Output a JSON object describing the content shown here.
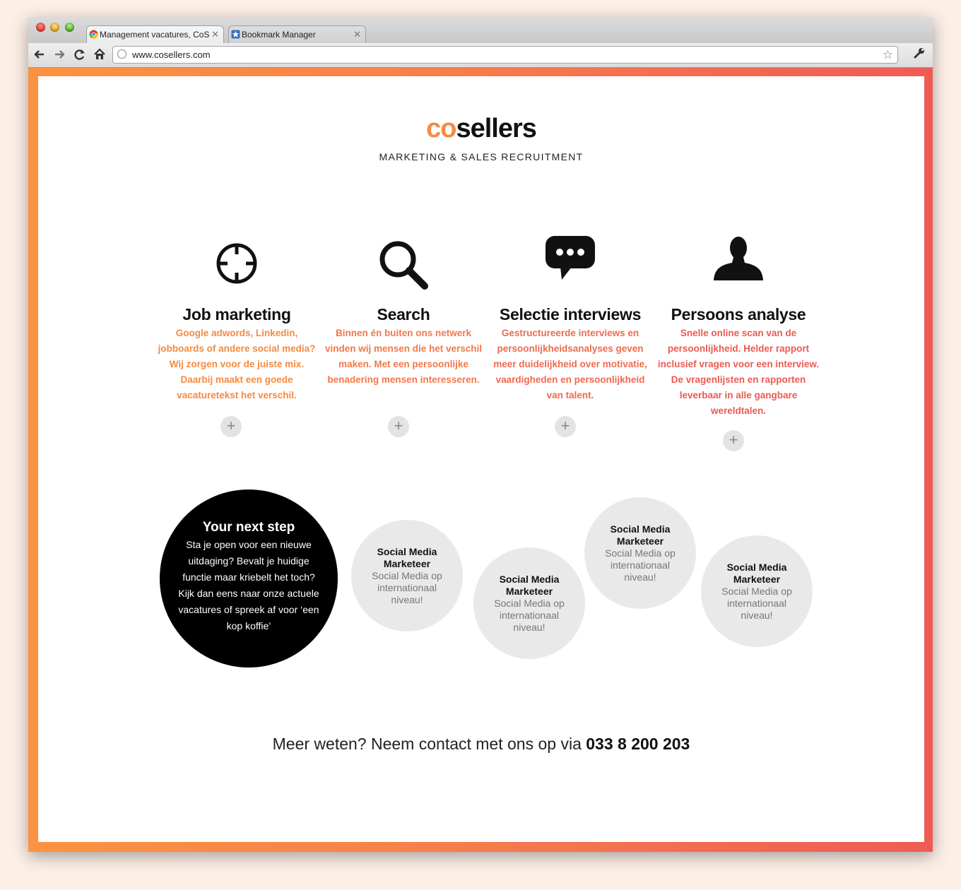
{
  "browser": {
    "tabs": [
      {
        "title": "Management vacatures, CoS",
        "icon": "chrome-icon",
        "active": true
      },
      {
        "title": "Bookmark Manager",
        "icon": "bookmark-star-icon",
        "active": false
      }
    ],
    "url": "www.cosellers.com",
    "nav_icons": [
      "back-arrow-icon",
      "forward-arrow-icon",
      "reload-icon",
      "home-icon"
    ]
  },
  "brand": {
    "logo_prefix": "co",
    "logo_suffix": "sellers",
    "tagline": "MARKETING & SALES RECRUITMENT",
    "accent_color": "#f58a45",
    "accent_color_2": "#ef5b54"
  },
  "features": [
    {
      "icon": "crosshair-icon",
      "title": "Job marketing",
      "text": "Google adwords, Linkedin, jobboards of andere social media? Wij zorgen voor de juiste mix. Daarbij maakt een goede vacaturetekst het verschil.",
      "color": "#f58a3f"
    },
    {
      "icon": "search-icon",
      "title": "Search",
      "text": "Binnen én buiten ons netwerk vinden wij mensen die het verschil maken. Met een persoonlijke benadering mensen interesseren.",
      "color": "#f3784a"
    },
    {
      "icon": "speech-bubble-icon",
      "title": "Selectie interviews",
      "text": "Gestructureerde interviews en persoonlijkheidsanalyses geven meer duidelijkheid over motivatie, vaardigheden en persoonlijkheid van talent.",
      "color": "#ef6a4f"
    },
    {
      "icon": "person-icon",
      "title": "Persoons analyse",
      "text": "Snelle online scan van de persoonlijkheid. Helder rapport inclusief vragen voor een interview. De vragenlijsten en rapporten leverbaar in alle gangbare wereldtalen.",
      "color": "#ec5a52"
    }
  ],
  "next_step": {
    "title": "Your next step",
    "text": "Sta je open voor een nieuwe uitdaging? Bevalt je huidige functie maar kriebelt het toch? Kijk dan eens naar onze actuele vacatures of spreek af voor ‘een kop koffie’"
  },
  "vacancies": [
    {
      "title": "Social Media Marketeer",
      "text": "Social Media op internationaal niveau!"
    },
    {
      "title": "Social Media Marketeer",
      "text": "Social Media op internationaal niveau!"
    },
    {
      "title": "Social Media Marketeer",
      "text": "Social Media op internationaal niveau!"
    },
    {
      "title": "Social Media Marketeer",
      "text": "Social Media op internationaal niveau!"
    }
  ],
  "contact": {
    "text": "Meer weten? Neem contact met ons op via",
    "phone": "033 8 200 203"
  },
  "plus_symbol": "+"
}
